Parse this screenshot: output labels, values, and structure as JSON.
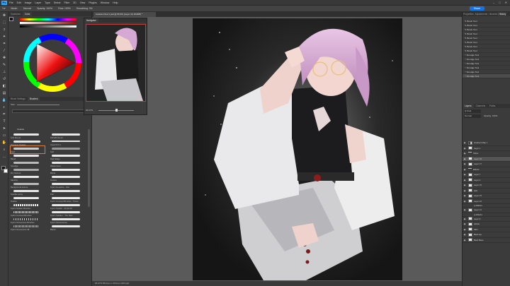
{
  "menubar": {
    "app_icon": "Ps",
    "items": [
      "File",
      "Edit",
      "Image",
      "Layer",
      "Type",
      "Select",
      "Filter",
      "3D",
      "View",
      "Plugins",
      "Window",
      "Help"
    ]
  },
  "options": {
    "items": [
      "Mode:",
      "Normal",
      "Opacity: 100%",
      "Flow: 100%",
      "Smoothing: 0%"
    ],
    "share_label": "Share"
  },
  "document": {
    "tab_title": "Celeste Final 1.psd @ 66.6% (Layer 19, RGB/8) *",
    "status": "66.67%     5614 px x 4724 px (300 ppi)"
  },
  "left_panel": {
    "top_tabs": [
      "Swatches",
      "Color"
    ],
    "mid_tabs": [
      "Brush Settings",
      "Brushes"
    ],
    "size_label": "Size:",
    "brushes_group": "Celeste",
    "brushes": [
      {
        "name": "Soft Round"
      },
      {
        "name": "Pressure Opacity"
      },
      {
        "name": "Hard"
      },
      {
        "name": "Blend"
      },
      {
        "name": "Smudge"
      },
      {
        "name": "Dry Texture"
      },
      {
        "name": "Sketchy"
      },
      {
        "name": "Background texture"
      },
      {
        "name": "Sparkle spray"
      },
      {
        "name": "Outline"
      },
      {
        "name": "Kyle's Spatter Brushes"
      },
      {
        "name": "Kyle's Concept Brushes"
      },
      {
        "name": "Kyle's Screentone Brushes"
      },
      {
        "name": "Kyle's Screentone 38"
      }
    ],
    "brushes_right": [
      {
        "name": "KW HB Pencil"
      },
      {
        "name": "Inked 8 Pt 1"
      },
      {
        "name": "Soft"
      },
      {
        "name": "Hard Edge"
      },
      {
        "name": "Watercolour"
      },
      {
        "name": "Blend"
      },
      {
        "name": "Texture"
      },
      {
        "name": "Kyle's Gouache - Flat"
      },
      {
        "name": "Flat"
      },
      {
        "name": "Kyle's Concept Brushes - Tubes"
      },
      {
        "name": "Kyle's Spatter - Drybrush"
      },
      {
        "name": "Kyle's Splatter - The Rain"
      },
      {
        "name": "Kyle's Screentones"
      },
      {
        "name": "Bloom"
      }
    ]
  },
  "navigator": {
    "title": "Navigator",
    "zoom": "66.67%"
  },
  "right_panel": {
    "top_tabs": [
      "Properties",
      "Adjustments",
      "Libraries",
      "History"
    ],
    "history": [
      "Brush Tool",
      "Brush Tool",
      "Brush Tool",
      "Brush Tool",
      "Brush Tool",
      "Brush Tool",
      "Brush Tool",
      "Brush Tool",
      "Smudge Tool",
      "Smudge Tool",
      "Smudge Tool",
      "Smudge Tool",
      "Smudge Tool",
      "Smudge Tool"
    ],
    "layer_tabs": [
      "Layers",
      "Channels",
      "Paths"
    ],
    "kind_label": "Q Kind",
    "blend_mode": "Normal",
    "opacity": "Opacity: 100%",
    "layers": [
      {
        "name": "Gradient Map 1",
        "type": "adj"
      },
      {
        "name": "Layer 1",
        "type": "layer"
      },
      {
        "name": "Shine",
        "type": "folder"
      },
      {
        "name": "Layer 19",
        "type": "layer",
        "selected": true
      },
      {
        "name": "Layer 17",
        "type": "layer"
      },
      {
        "name": "Effects",
        "type": "folder"
      },
      {
        "name": "Layer 7",
        "type": "layer"
      },
      {
        "name": "Layer 4",
        "type": "layer"
      },
      {
        "name": "Layer 15",
        "type": "layer"
      },
      {
        "name": "Hair",
        "type": "layer"
      },
      {
        "name": "Layer 15",
        "type": "layer"
      },
      {
        "name": "Layer 22",
        "type": "layer"
      },
      {
        "name": "Effects",
        "type": "fx"
      },
      {
        "name": "Layer 21",
        "type": "layer"
      },
      {
        "name": "Effects",
        "type": "fx"
      },
      {
        "name": "Layer 9",
        "type": "layer"
      },
      {
        "name": "Jacket",
        "type": "layer"
      },
      {
        "name": "Skin",
        "type": "layer"
      },
      {
        "name": "Back top",
        "type": "layer"
      },
      {
        "name": "Back Base",
        "type": "layer"
      }
    ]
  },
  "colors": {
    "accent": "#31a8ff",
    "share": "#1473e6",
    "brush_select": "#e0793a"
  }
}
